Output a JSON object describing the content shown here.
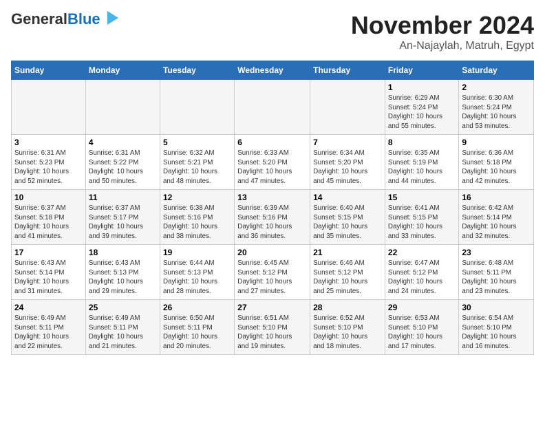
{
  "header": {
    "logo_line1": "General",
    "logo_line2": "Blue",
    "title": "November 2024",
    "subtitle": "An-Najaylah, Matruh, Egypt"
  },
  "weekdays": [
    "Sunday",
    "Monday",
    "Tuesday",
    "Wednesday",
    "Thursday",
    "Friday",
    "Saturday"
  ],
  "weeks": [
    [
      {
        "day": "",
        "info": ""
      },
      {
        "day": "",
        "info": ""
      },
      {
        "day": "",
        "info": ""
      },
      {
        "day": "",
        "info": ""
      },
      {
        "day": "",
        "info": ""
      },
      {
        "day": "1",
        "info": "Sunrise: 6:29 AM\nSunset: 5:24 PM\nDaylight: 10 hours\nand 55 minutes."
      },
      {
        "day": "2",
        "info": "Sunrise: 6:30 AM\nSunset: 5:24 PM\nDaylight: 10 hours\nand 53 minutes."
      }
    ],
    [
      {
        "day": "3",
        "info": "Sunrise: 6:31 AM\nSunset: 5:23 PM\nDaylight: 10 hours\nand 52 minutes."
      },
      {
        "day": "4",
        "info": "Sunrise: 6:31 AM\nSunset: 5:22 PM\nDaylight: 10 hours\nand 50 minutes."
      },
      {
        "day": "5",
        "info": "Sunrise: 6:32 AM\nSunset: 5:21 PM\nDaylight: 10 hours\nand 48 minutes."
      },
      {
        "day": "6",
        "info": "Sunrise: 6:33 AM\nSunset: 5:20 PM\nDaylight: 10 hours\nand 47 minutes."
      },
      {
        "day": "7",
        "info": "Sunrise: 6:34 AM\nSunset: 5:20 PM\nDaylight: 10 hours\nand 45 minutes."
      },
      {
        "day": "8",
        "info": "Sunrise: 6:35 AM\nSunset: 5:19 PM\nDaylight: 10 hours\nand 44 minutes."
      },
      {
        "day": "9",
        "info": "Sunrise: 6:36 AM\nSunset: 5:18 PM\nDaylight: 10 hours\nand 42 minutes."
      }
    ],
    [
      {
        "day": "10",
        "info": "Sunrise: 6:37 AM\nSunset: 5:18 PM\nDaylight: 10 hours\nand 41 minutes."
      },
      {
        "day": "11",
        "info": "Sunrise: 6:37 AM\nSunset: 5:17 PM\nDaylight: 10 hours\nand 39 minutes."
      },
      {
        "day": "12",
        "info": "Sunrise: 6:38 AM\nSunset: 5:16 PM\nDaylight: 10 hours\nand 38 minutes."
      },
      {
        "day": "13",
        "info": "Sunrise: 6:39 AM\nSunset: 5:16 PM\nDaylight: 10 hours\nand 36 minutes."
      },
      {
        "day": "14",
        "info": "Sunrise: 6:40 AM\nSunset: 5:15 PM\nDaylight: 10 hours\nand 35 minutes."
      },
      {
        "day": "15",
        "info": "Sunrise: 6:41 AM\nSunset: 5:15 PM\nDaylight: 10 hours\nand 33 minutes."
      },
      {
        "day": "16",
        "info": "Sunrise: 6:42 AM\nSunset: 5:14 PM\nDaylight: 10 hours\nand 32 minutes."
      }
    ],
    [
      {
        "day": "17",
        "info": "Sunrise: 6:43 AM\nSunset: 5:14 PM\nDaylight: 10 hours\nand 31 minutes."
      },
      {
        "day": "18",
        "info": "Sunrise: 6:43 AM\nSunset: 5:13 PM\nDaylight: 10 hours\nand 29 minutes."
      },
      {
        "day": "19",
        "info": "Sunrise: 6:44 AM\nSunset: 5:13 PM\nDaylight: 10 hours\nand 28 minutes."
      },
      {
        "day": "20",
        "info": "Sunrise: 6:45 AM\nSunset: 5:12 PM\nDaylight: 10 hours\nand 27 minutes."
      },
      {
        "day": "21",
        "info": "Sunrise: 6:46 AM\nSunset: 5:12 PM\nDaylight: 10 hours\nand 25 minutes."
      },
      {
        "day": "22",
        "info": "Sunrise: 6:47 AM\nSunset: 5:12 PM\nDaylight: 10 hours\nand 24 minutes."
      },
      {
        "day": "23",
        "info": "Sunrise: 6:48 AM\nSunset: 5:11 PM\nDaylight: 10 hours\nand 23 minutes."
      }
    ],
    [
      {
        "day": "24",
        "info": "Sunrise: 6:49 AM\nSunset: 5:11 PM\nDaylight: 10 hours\nand 22 minutes."
      },
      {
        "day": "25",
        "info": "Sunrise: 6:49 AM\nSunset: 5:11 PM\nDaylight: 10 hours\nand 21 minutes."
      },
      {
        "day": "26",
        "info": "Sunrise: 6:50 AM\nSunset: 5:11 PM\nDaylight: 10 hours\nand 20 minutes."
      },
      {
        "day": "27",
        "info": "Sunrise: 6:51 AM\nSunset: 5:10 PM\nDaylight: 10 hours\nand 19 minutes."
      },
      {
        "day": "28",
        "info": "Sunrise: 6:52 AM\nSunset: 5:10 PM\nDaylight: 10 hours\nand 18 minutes."
      },
      {
        "day": "29",
        "info": "Sunrise: 6:53 AM\nSunset: 5:10 PM\nDaylight: 10 hours\nand 17 minutes."
      },
      {
        "day": "30",
        "info": "Sunrise: 6:54 AM\nSunset: 5:10 PM\nDaylight: 10 hours\nand 16 minutes."
      }
    ]
  ]
}
